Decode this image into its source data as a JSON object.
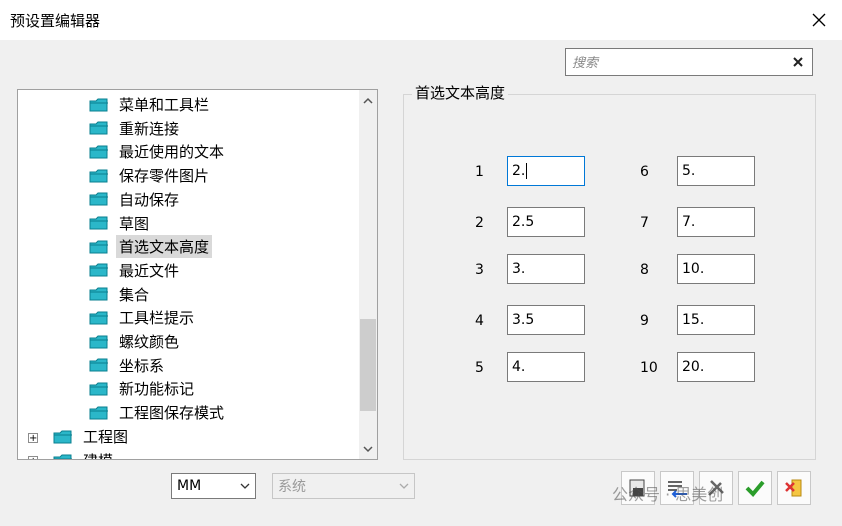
{
  "window": {
    "title": "预设置编辑器"
  },
  "search": {
    "placeholder": "搜索"
  },
  "tree": {
    "children": [
      {
        "label": "菜单和工具栏"
      },
      {
        "label": "重新连接"
      },
      {
        "label": "最近使用的文本"
      },
      {
        "label": "保存零件图片"
      },
      {
        "label": "自动保存"
      },
      {
        "label": "草图"
      },
      {
        "label": "首选文本高度",
        "selected": true
      },
      {
        "label": "最近文件"
      },
      {
        "label": "集合"
      },
      {
        "label": "工具栏提示"
      },
      {
        "label": "螺纹颜色"
      },
      {
        "label": "坐标系"
      },
      {
        "label": "新功能标记"
      },
      {
        "label": "工程图保存模式"
      }
    ],
    "top_nodes": [
      {
        "label": "工程图"
      },
      {
        "label": "建模"
      }
    ]
  },
  "panel": {
    "title": "首选文本高度",
    "fields": [
      {
        "index": "1",
        "value": "2."
      },
      {
        "index": "2",
        "value": "2.5"
      },
      {
        "index": "3",
        "value": "3."
      },
      {
        "index": "4",
        "value": "3.5"
      },
      {
        "index": "5",
        "value": "4."
      },
      {
        "index": "6",
        "value": "5."
      },
      {
        "index": "7",
        "value": "7."
      },
      {
        "index": "8",
        "value": "10."
      },
      {
        "index": "9",
        "value": "15."
      },
      {
        "index": "10",
        "value": "20."
      }
    ]
  },
  "bottom": {
    "units": "MM",
    "system": "系统"
  },
  "watermark": "公众号 · 思美创",
  "colors": {
    "accent": "#0078d7",
    "folder": "#28b8c8",
    "ok_green": "#2a9d2a"
  },
  "icons": [
    "close-icon",
    "search-clear-icon",
    "folder-icon",
    "scroll-up-icon",
    "scroll-down-icon",
    "dropdown-icon",
    "import-icon",
    "export-icon",
    "tools-icon",
    "ok-check-icon",
    "cancel-icon"
  ]
}
